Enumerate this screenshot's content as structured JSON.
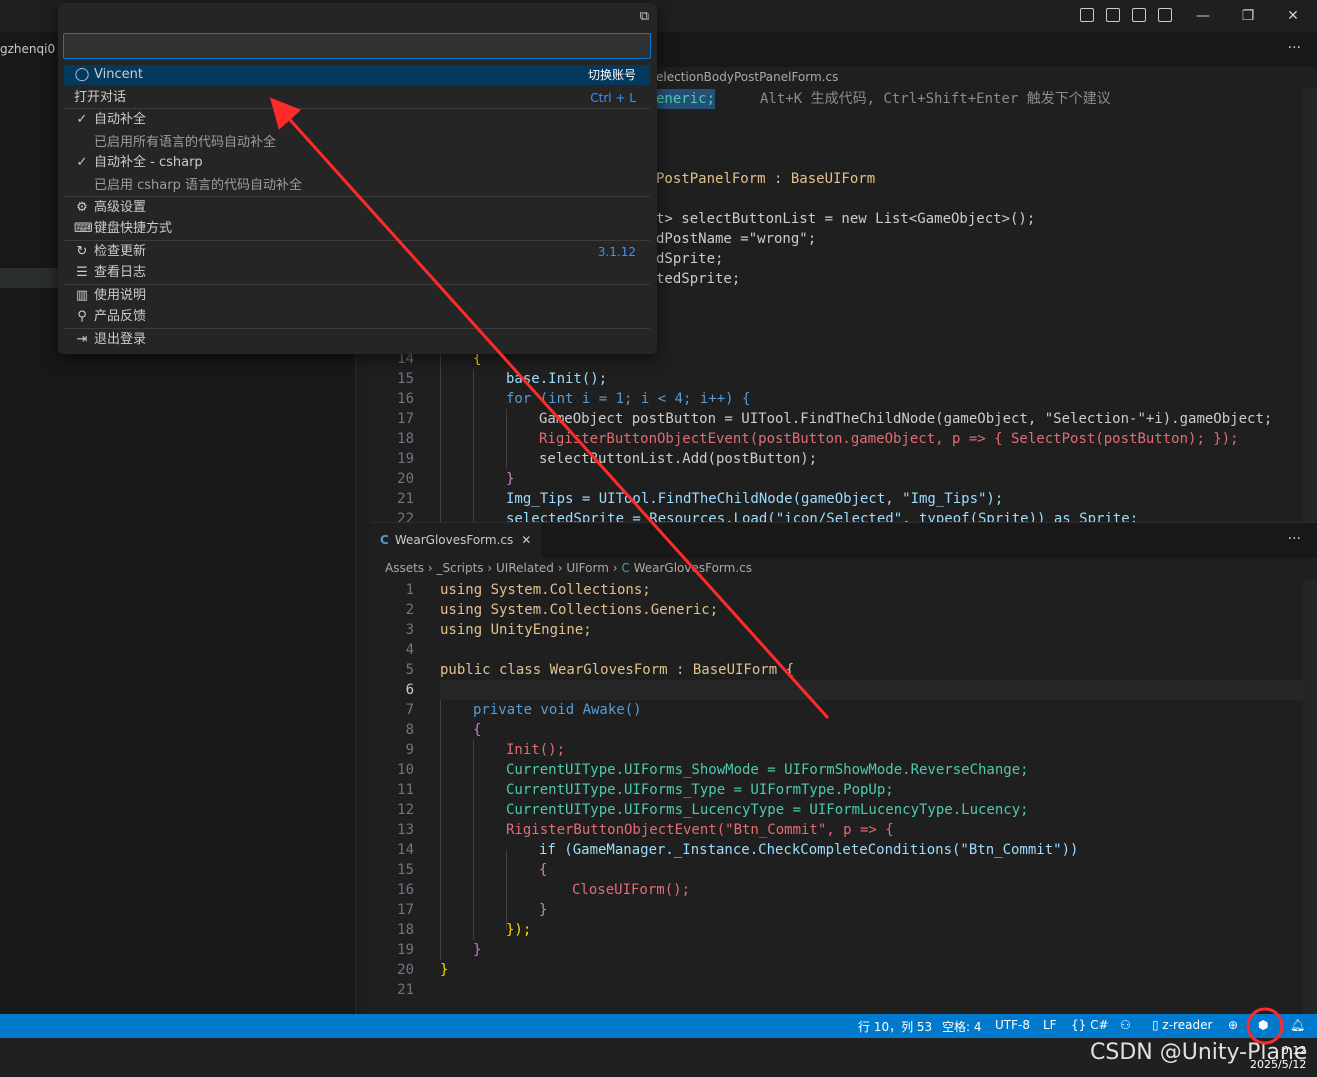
{
  "sidebar": {
    "label": "gzhenqi0"
  },
  "editor_top": {
    "tab_label": "electionBodyPostPanelForm.cs",
    "hint": "Alt+K 生成代码, Ctrl+Shift+Enter 触发下个建议",
    "lines": [
      {
        "n": "",
        "text": "eneric;"
      },
      {
        "n": "",
        "text": "PostPanelForm : BaseUIForm"
      },
      {
        "n": "",
        "text": "t> selectButtonList = new List<GameObject>();"
      },
      {
        "n": "",
        "text": "dPostName =\"wrong\";"
      },
      {
        "n": "",
        "text": "dSprite;"
      },
      {
        "n": "",
        "text": "tedSprite;"
      },
      {
        "n": "14",
        "text": "{"
      },
      {
        "n": "15",
        "text": "base.Init();"
      },
      {
        "n": "16",
        "text": "for (int i = 1; i < 4; i++) {"
      },
      {
        "n": "17",
        "text": "GameObject postButton = UITool.FindTheChildNode(gameObject, \"Selection-\"+i).gameObject;"
      },
      {
        "n": "18",
        "text": "RigisterButtonObjectEvent(postButton.gameObject, p => { SelectPost(postButton); });"
      },
      {
        "n": "19",
        "text": "selectButtonList.Add(postButton);"
      },
      {
        "n": "20",
        "text": "}"
      },
      {
        "n": "21",
        "text": "Img_Tips = UITool.FindTheChildNode(gameObject, \"Img_Tips\");"
      },
      {
        "n": "22",
        "text": "selectedSprite = Resources.Load(\"icon/Selected\", typeof(Sprite)) as Sprite;"
      }
    ]
  },
  "editor_bottom": {
    "tab_label": "WearGlovesForm.cs",
    "breadcrumb": [
      "Assets",
      "_Scripts",
      "UIRelated",
      "UIForm",
      "WearGlovesForm.cs"
    ],
    "lines": [
      {
        "n": "1",
        "text": "using System.Collections;"
      },
      {
        "n": "2",
        "text": "using System.Collections.Generic;"
      },
      {
        "n": "3",
        "text": "using UnityEngine;"
      },
      {
        "n": "4",
        "text": ""
      },
      {
        "n": "5",
        "text": "public class WearGlovesForm : BaseUIForm {"
      },
      {
        "n": "6",
        "text": ""
      },
      {
        "n": "7",
        "text": "private void Awake()"
      },
      {
        "n": "8",
        "text": "{"
      },
      {
        "n": "9",
        "text": "Init();"
      },
      {
        "n": "10",
        "text": "CurrentUIType.UIForms_ShowMode = UIFormShowMode.ReverseChange;"
      },
      {
        "n": "11",
        "text": "CurrentUIType.UIForms_Type = UIFormType.PopUp;"
      },
      {
        "n": "12",
        "text": "CurrentUIType.UIForms_LucencyType = UIFormLucencyType.Lucency;"
      },
      {
        "n": "13",
        "text": "RigisterButtonObjectEvent(\"Btn_Commit\", p => {"
      },
      {
        "n": "14",
        "text": "if (GameManager._Instance.CheckCompleteConditions(\"Btn_Commit\"))"
      },
      {
        "n": "15",
        "text": "{"
      },
      {
        "n": "16",
        "text": "CloseUIForm();"
      },
      {
        "n": "17",
        "text": "}"
      },
      {
        "n": "18",
        "text": "});"
      },
      {
        "n": "19",
        "text": "}"
      },
      {
        "n": "20",
        "text": "}"
      },
      {
        "n": "21",
        "text": ""
      }
    ]
  },
  "menu": {
    "account_name": "Vincent",
    "switch_account": "切换账号",
    "open_chat": "打开对话",
    "open_chat_shortcut": "Ctrl + L",
    "autocomplete": "自动补全",
    "autocomplete_desc": "已启用所有语言的代码自动补全",
    "autocomplete_cs": "自动补全 - csharp",
    "autocomplete_cs_desc": "已启用 csharp 语言的代码自动补全",
    "advanced": "高级设置",
    "shortcuts": "键盘快捷方式",
    "check_update": "检查更新",
    "version": "3.1.12",
    "view_log": "查看日志",
    "manual": "使用说明",
    "feedback": "产品反馈",
    "logout": "退出登录"
  },
  "statusbar": {
    "position": "行 10，列 53",
    "spaces": "空格: 4",
    "encoding": "UTF-8",
    "eol": "LF",
    "language": "{} C#",
    "reader": "z-reader"
  },
  "taskbar": {
    "watermark": "CSDN @Unity-Plane",
    "time": "0:12",
    "date": "2025/5/12"
  },
  "colors": {
    "accent": "#0078d4",
    "statusbar": "#007acc",
    "arrow": "#ff2a2a"
  }
}
